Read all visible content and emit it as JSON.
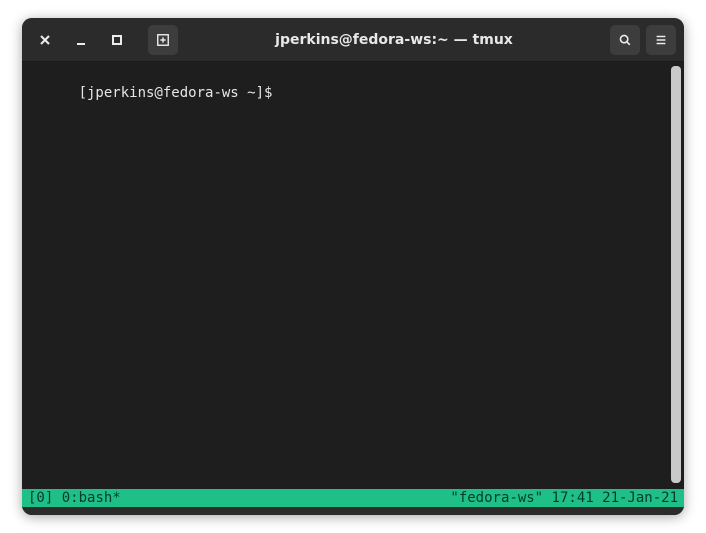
{
  "titlebar": {
    "title": "jperkins@fedora-ws:~ — tmux"
  },
  "terminal": {
    "prompt": "[jperkins@fedora-ws ~]$ "
  },
  "tmux": {
    "session": "[0]",
    "window": "0:bash*",
    "hostname": "\"fedora-ws\"",
    "time": "17:41",
    "date": "21-Jan-21"
  }
}
